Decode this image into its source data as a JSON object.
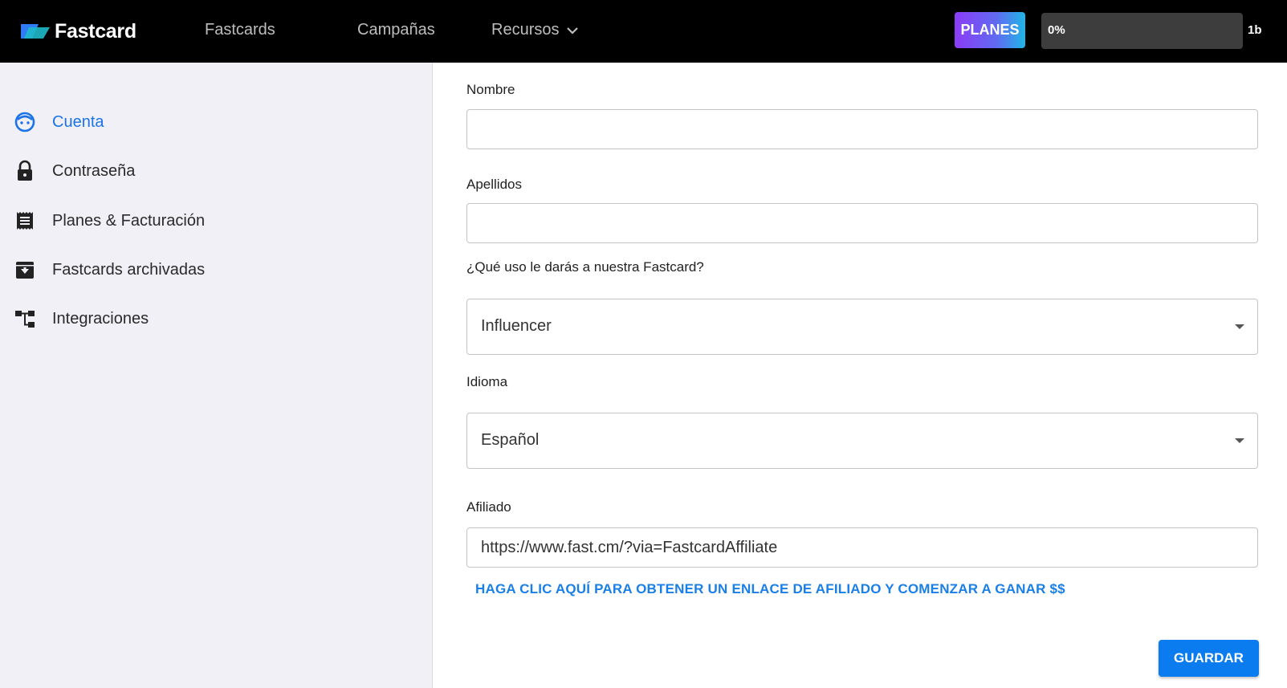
{
  "header": {
    "brand": "Fastcard",
    "nav": {
      "fastcards": "Fastcards",
      "campanas": "Campañas",
      "recursos": "Recursos"
    },
    "planes_label": "PLANES",
    "progress": {
      "text": "0%",
      "value": 0
    },
    "quota": "1b"
  },
  "sidebar": {
    "items": [
      {
        "label": "Cuenta",
        "icon": "face-icon",
        "active": true
      },
      {
        "label": "Contraseña",
        "icon": "lock-icon",
        "active": false
      },
      {
        "label": "Planes & Facturación",
        "icon": "receipt-icon",
        "active": false
      },
      {
        "label": "Fastcards archivadas",
        "icon": "archive-icon",
        "active": false
      },
      {
        "label": "Integraciones",
        "icon": "integrations-icon",
        "active": false
      }
    ]
  },
  "form": {
    "nombre": {
      "label": "Nombre",
      "value": ""
    },
    "apellidos": {
      "label": "Apellidos",
      "value": ""
    },
    "uso": {
      "label": "¿Qué uso le darás a nuestra Fastcard?",
      "value": "Influencer"
    },
    "idioma": {
      "label": "Idioma",
      "value": "Español"
    },
    "afiliado": {
      "label": "Afiliado",
      "value": "https://www.fast.cm/?via=FastcardAffiliate"
    },
    "affiliate_link": "HAGA CLIC AQUÍ PARA OBTENER UN ENLACE DE AFILIADO Y COMENZAR A GANAR $$",
    "save_label": "GUARDAR"
  },
  "colors": {
    "accent": "#1a73e8",
    "save_button": "#0a7cf0",
    "topbar": "#000000",
    "sidebar_bg": "#f1f0f6"
  }
}
